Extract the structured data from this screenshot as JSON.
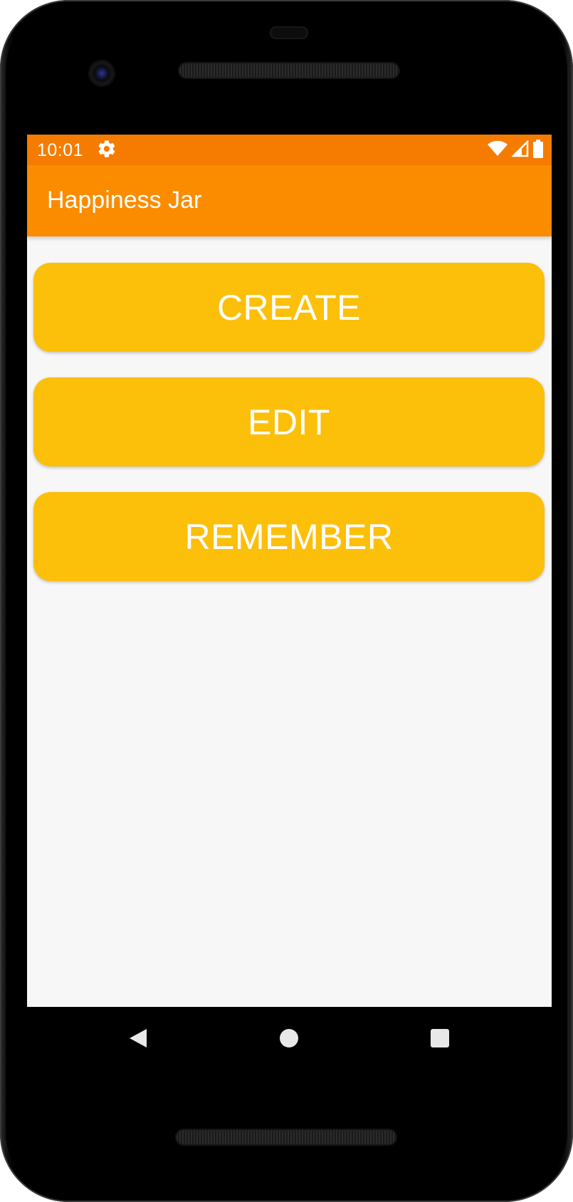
{
  "status_bar": {
    "time": "10:01",
    "icons": [
      "gear-icon",
      "wifi-icon",
      "signal-icon",
      "battery-icon"
    ]
  },
  "app_bar": {
    "title": "Happiness Jar"
  },
  "buttons": [
    {
      "label": "CREATE"
    },
    {
      "label": "EDIT"
    },
    {
      "label": "REMEMBER"
    }
  ],
  "navigation": {
    "icons": [
      "back-icon",
      "home-icon",
      "recents-icon"
    ]
  },
  "colors": {
    "status_bar": "#f57c00",
    "app_bar": "#fb8c00",
    "button": "#fcbf0a",
    "button_text": "#ffffff",
    "screen_background": "#f7f7f7"
  }
}
